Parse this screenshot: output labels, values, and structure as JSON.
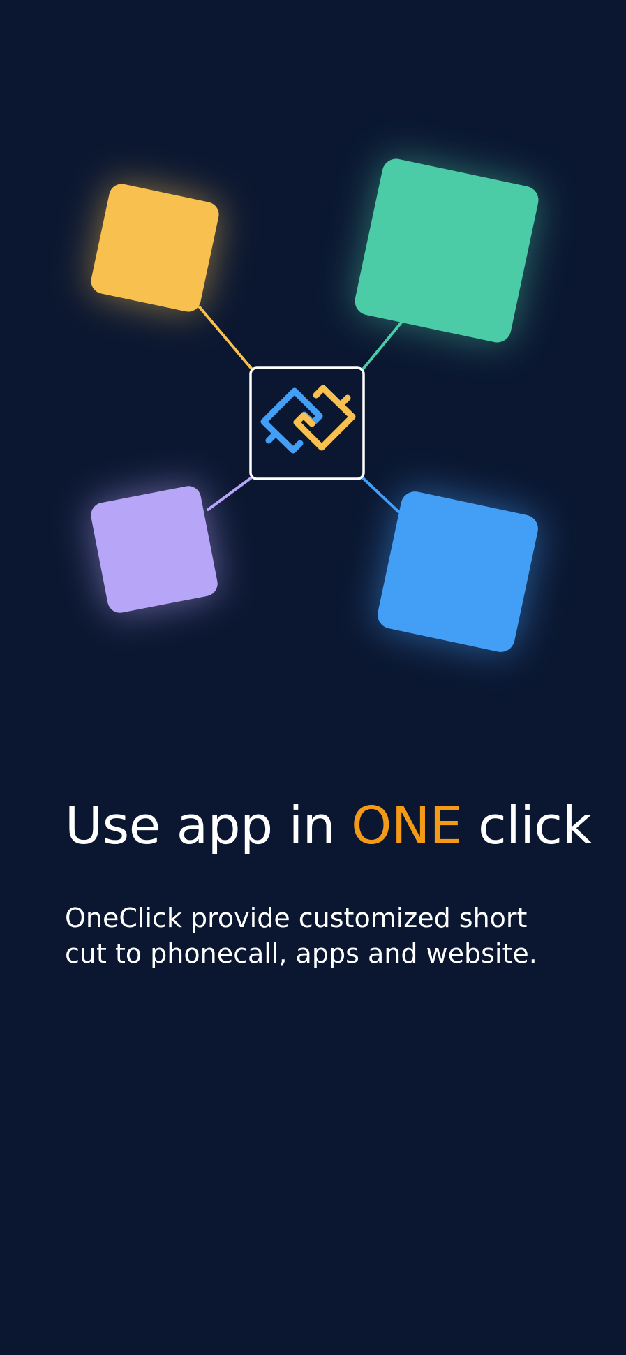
{
  "onboarding": {
    "headline_before": "Use app in ",
    "headline_accent": "ONE",
    "headline_after": " click",
    "description": "OneClick provide customized short cut to phonecall, apps and website."
  },
  "colors": {
    "background": "#0b1731",
    "accent": "#f59a16",
    "tile_yellow": "#f8c04e",
    "tile_green": "#4bcca6",
    "tile_purple": "#b7a6f7",
    "tile_blue": "#439ef5"
  },
  "icons": {
    "center": "link-icon"
  }
}
